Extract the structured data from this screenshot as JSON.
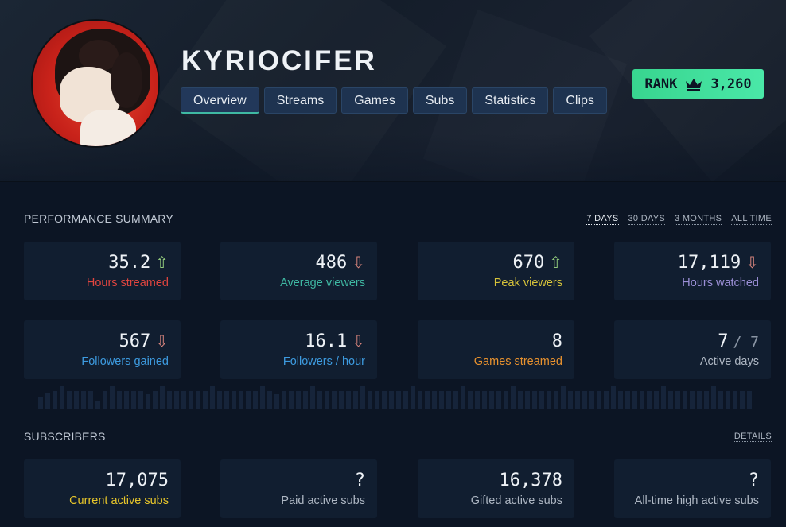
{
  "channel": {
    "name": "KYRIOCIFER"
  },
  "tabs": [
    {
      "label": "Overview",
      "active": true
    },
    {
      "label": "Streams",
      "active": false
    },
    {
      "label": "Games",
      "active": false
    },
    {
      "label": "Subs",
      "active": false
    },
    {
      "label": "Statistics",
      "active": false
    },
    {
      "label": "Clips",
      "active": false
    }
  ],
  "rank": {
    "label": "RANK",
    "icon": "crown-icon",
    "value": "3,260",
    "color": "#3fe29c"
  },
  "performance": {
    "title": "PERFORMANCE SUMMARY",
    "ranges": [
      "7 DAYS",
      "30 DAYS",
      "3 MONTHS",
      "ALL TIME"
    ],
    "active_range": "7 DAYS",
    "cards": [
      {
        "value": "35.2",
        "trend": "up",
        "label": "Hours streamed",
        "color": "#e0453f"
      },
      {
        "value": "486",
        "trend": "down",
        "label": "Average viewers",
        "color": "#3fb9a3"
      },
      {
        "value": "670",
        "trend": "up",
        "label": "Peak viewers",
        "color": "#d7c43a"
      },
      {
        "value": "17,119",
        "trend": "down",
        "label": "Hours watched",
        "color": "#9b8fd6"
      },
      {
        "value": "567",
        "trend": "down",
        "label": "Followers gained",
        "color": "#3d9be0"
      },
      {
        "value": "16.1",
        "trend": "down",
        "label": "Followers / hour",
        "color": "#3d9be0"
      },
      {
        "value": "8",
        "trend": "none",
        "label": "Games streamed",
        "color": "#e9922e"
      },
      {
        "value": "7",
        "suffix": "/ 7",
        "trend": "none",
        "label": "Active days",
        "color": "#aeb7c3"
      }
    ]
  },
  "subscribers": {
    "title": "SUBSCRIBERS",
    "details_label": "DETAILS",
    "cards": [
      {
        "value": "17,075",
        "label": "Current active subs",
        "color": "#e8c62a"
      },
      {
        "value": "?",
        "label": "Paid active subs",
        "color": "#aeb7c3"
      },
      {
        "value": "16,378",
        "label": "Gifted active subs",
        "color": "#aeb7c3"
      },
      {
        "value": "?",
        "label": "All-time high active subs",
        "color": "#aeb7c3"
      }
    ]
  },
  "icons": {
    "up": "arrow-up-icon",
    "down": "arrow-down-icon"
  },
  "glyphs": {
    "up": "⇧",
    "down": "⇩"
  }
}
